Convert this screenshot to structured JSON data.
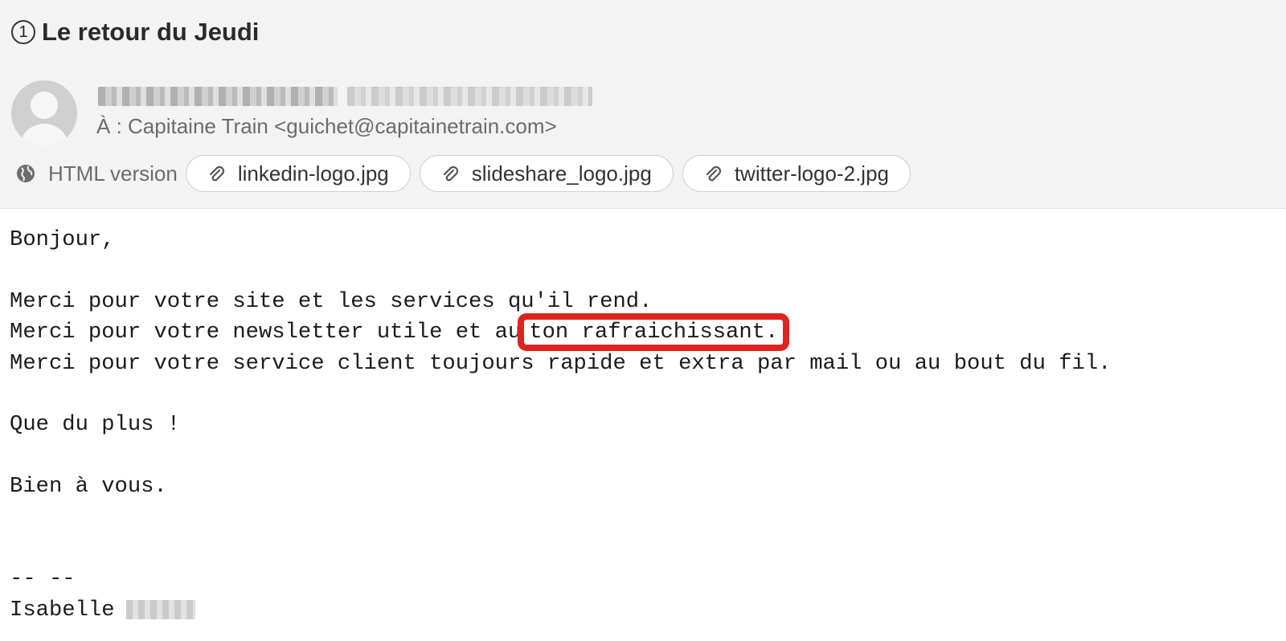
{
  "message": {
    "thread_count": "1",
    "subject": "Le retour du Jeudi",
    "recipient": "À : Capitaine Train <guichet@capitainetrain.com>",
    "html_version_label": "HTML version",
    "attachments": [
      {
        "name": "linkedin-logo.jpg"
      },
      {
        "name": "slideshare_logo.jpg"
      },
      {
        "name": "twitter-logo-2.jpg"
      }
    ]
  },
  "body": {
    "greeting": "Bonjour,",
    "line1": "Merci pour votre site et les services qu'il rend.",
    "line2_prefix": "Merci pour votre newsletter utile et au",
    "line2_highlight": "ton rafraichissant.",
    "line3": "Merci pour votre service client toujours rapide et extra par mail ou au bout du fil.",
    "line4": "Que du plus !",
    "closing": "Bien à vous.",
    "signature_separator": "-- --",
    "signature_name": "Isabelle"
  },
  "colors": {
    "highlight_border": "#e0231f",
    "header_background": "#f3f3f3"
  },
  "icons": {
    "globe": "globe-icon",
    "attachment": "paperclip-icon",
    "avatar": "user-avatar-icon"
  }
}
